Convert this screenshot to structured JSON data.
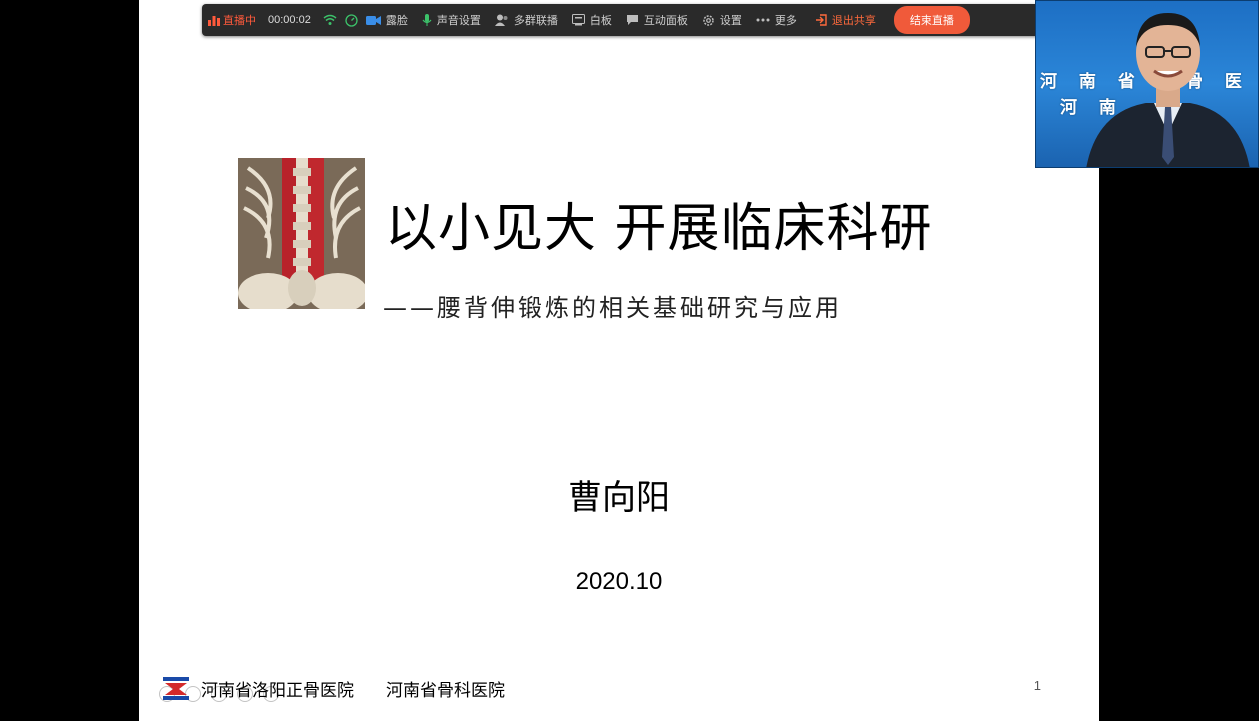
{
  "toolbar": {
    "live_label": "直播中",
    "timer": "00:00:02",
    "items": [
      {
        "label": "露脸"
      },
      {
        "label": "声音设置"
      },
      {
        "label": "多群联播"
      },
      {
        "label": "白板"
      },
      {
        "label": "互动面板"
      },
      {
        "label": "设置"
      },
      {
        "label": "更多"
      }
    ],
    "exit_label": "退出共享",
    "end_label": "结束直播"
  },
  "slide": {
    "title": "以小见大  开展临床科研",
    "subtitle": "——腰背伸锻炼的相关基础研究与应用",
    "author": "曹向阳",
    "date": "2020.10",
    "footer": {
      "hospital_1": "河南省洛阳正骨医院",
      "hospital_2": "河南省骨科医院"
    },
    "page_number": "1"
  },
  "webcam": {
    "backdrop_line_1": "河 南 省 洛",
    "backdrop_line_1b": "骨 医 院",
    "backdrop_line_2": "河 南"
  },
  "colors": {
    "accent": "#f05a3a",
    "live": "#ff5a3c",
    "toolbar_bg": "#2a2a2a",
    "webcam_bg": "#2b86d8"
  }
}
